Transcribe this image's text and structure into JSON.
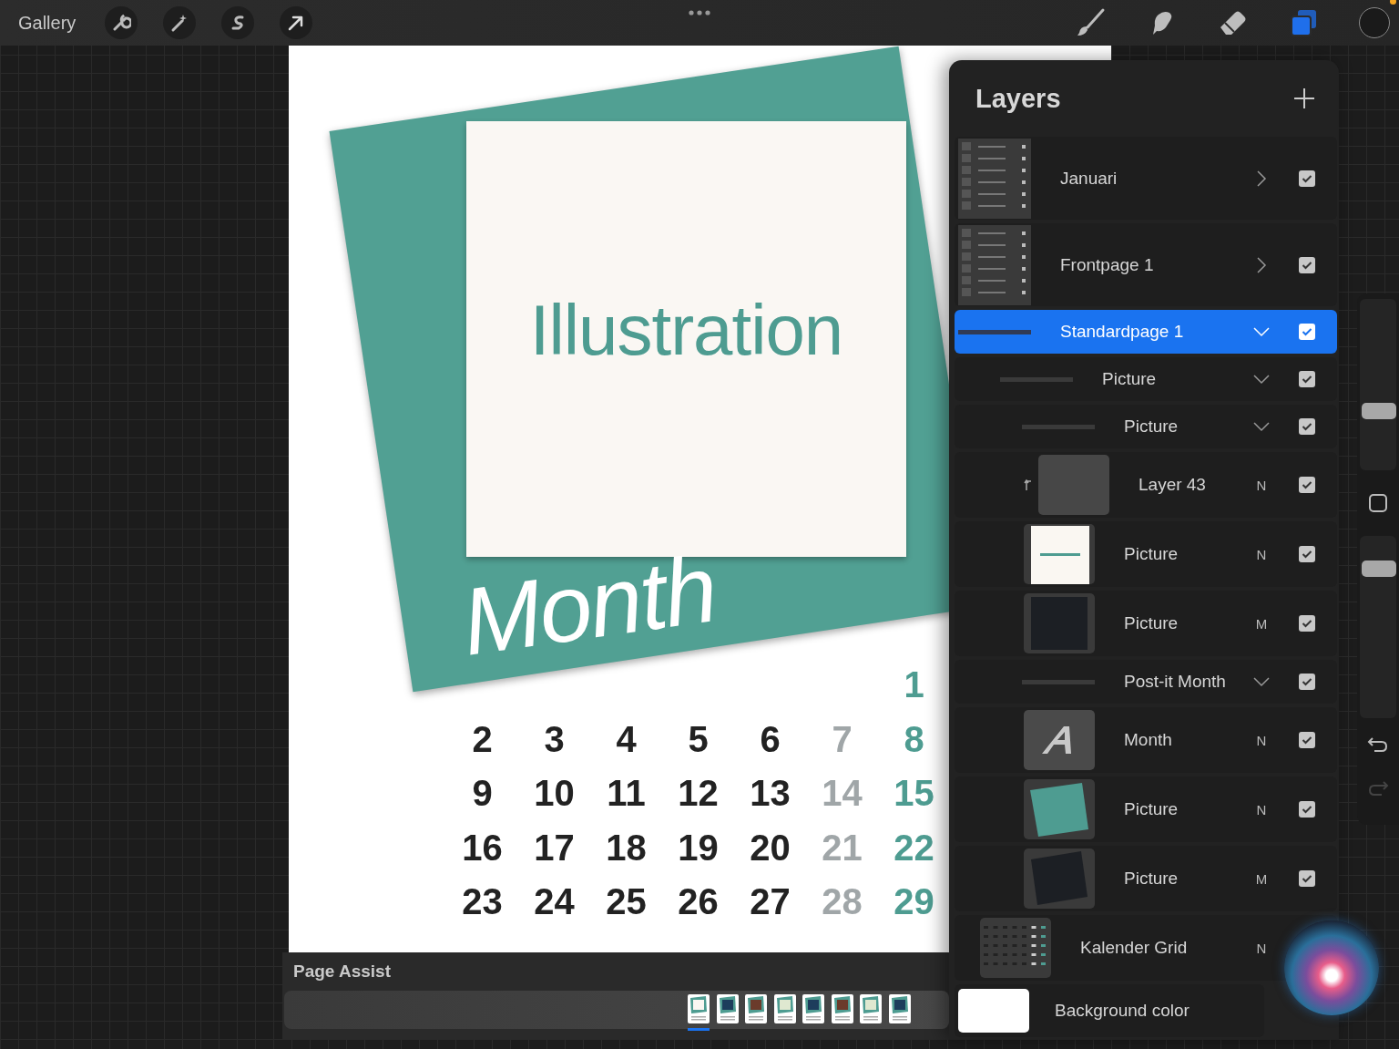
{
  "toolbar": {
    "gallery": "Gallery",
    "tools": [
      {
        "kind": "brush",
        "selected": false
      },
      {
        "kind": "smudge",
        "selected": false
      },
      {
        "kind": "eraser",
        "selected": false
      },
      {
        "kind": "layers",
        "selected": true
      }
    ]
  },
  "canvas": {
    "title": "Illustration",
    "month": "Month",
    "weeks": [
      [
        "1"
      ],
      [
        "2",
        "3",
        "4",
        "5",
        "6",
        "7",
        "8"
      ],
      [
        "9",
        "10",
        "11",
        "12",
        "13",
        "14",
        "15"
      ],
      [
        "16",
        "17",
        "18",
        "19",
        "20",
        "21",
        "22"
      ],
      [
        "23",
        "24",
        "25",
        "26",
        "27",
        "28",
        "29"
      ]
    ]
  },
  "layers": {
    "title": "Layers",
    "items": [
      {
        "kind": "group",
        "name": "Januari",
        "thumbnail": {
          "kind": "layers-preview"
        },
        "expanded": false,
        "selected": false,
        "visible": true
      },
      {
        "kind": "group",
        "name": "Frontpage 1",
        "thumbnail": {
          "kind": "layers-preview"
        },
        "expanded": false,
        "selected": false,
        "visible": true
      },
      {
        "kind": "group",
        "name": "Standardpage 1",
        "expanded": true,
        "selected": true,
        "visible": true,
        "children": [
          {
            "kind": "group",
            "name": "Picture",
            "expanded": true,
            "selected": false,
            "visible": true,
            "children": [
              {
                "kind": "group",
                "name": "Picture",
                "expanded": true,
                "selected": false,
                "visible": true,
                "children": [
                  {
                    "kind": "layer",
                    "name": "Layer 43",
                    "thumbnail": {
                      "kind": "empty"
                    },
                    "blend": "N",
                    "clipped": true,
                    "selected": false,
                    "visible": true
                  },
                  {
                    "kind": "layer",
                    "name": "Picture",
                    "thumbnail": {
                      "kind": "note"
                    },
                    "blend": "N",
                    "clipped": false,
                    "selected": false,
                    "visible": true
                  },
                  {
                    "kind": "layer",
                    "name": "Picture",
                    "thumbnail": {
                      "kind": "dark"
                    },
                    "blend": "M",
                    "clipped": false,
                    "selected": false,
                    "visible": true
                  }
                ]
              },
              {
                "kind": "group",
                "name": "Post-it Month",
                "expanded": true,
                "selected": false,
                "visible": true,
                "children": [
                  {
                    "kind": "layer",
                    "name": "Month",
                    "thumbnail": {
                      "kind": "letter"
                    },
                    "blend": "N",
                    "clipped": false,
                    "selected": false,
                    "visible": true
                  },
                  {
                    "kind": "layer",
                    "name": "Picture",
                    "thumbnail": {
                      "kind": "teal"
                    },
                    "blend": "N",
                    "clipped": false,
                    "selected": false,
                    "visible": true
                  },
                  {
                    "kind": "layer",
                    "name": "Picture",
                    "thumbnail": {
                      "kind": "dark-tilted"
                    },
                    "blend": "M",
                    "clipped": false,
                    "selected": false,
                    "visible": true
                  }
                ]
              }
            ]
          },
          {
            "kind": "layer",
            "name": "Kalender Grid",
            "thumbnail": {
              "kind": "calendar"
            },
            "blend": "N",
            "clipped": false,
            "selected": false
          }
        ]
      },
      {
        "kind": "background",
        "name": "Background color",
        "thumbnail": {
          "kind": "white"
        },
        "selected": false
      }
    ]
  },
  "sidebar": {
    "sliders": [
      {
        "kind": "size",
        "level": 0.33
      },
      {
        "kind": "opacity",
        "level": 0.85
      }
    ]
  },
  "page_assist": {
    "title": "Page Assist",
    "pages": [
      {
        "selected": true
      },
      {
        "selected": false
      },
      {
        "selected": false
      },
      {
        "selected": false
      },
      {
        "selected": false
      },
      {
        "selected": false
      },
      {
        "selected": false
      },
      {
        "selected": false
      }
    ]
  }
}
